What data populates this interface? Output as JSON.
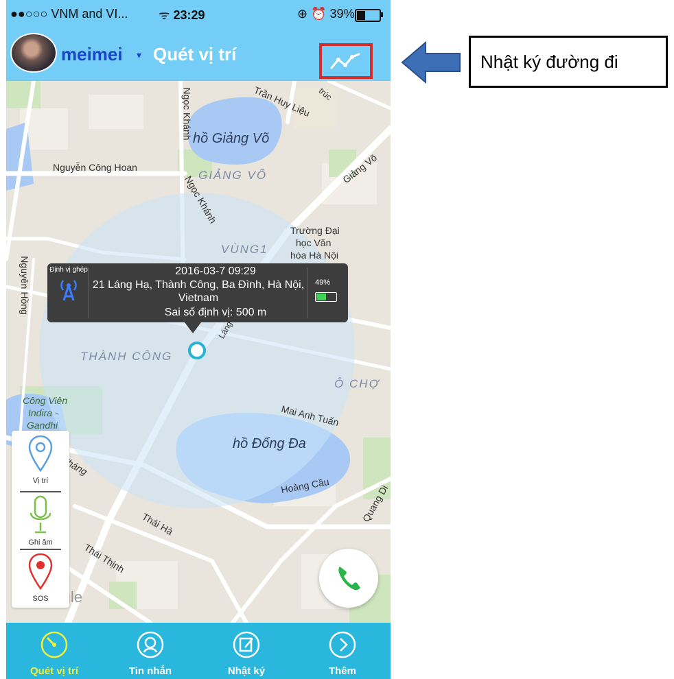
{
  "status_bar": {
    "carrier": "●●○○○ VNM and VI...",
    "time": "23:29",
    "battery": "39%"
  },
  "nav": {
    "user_name": "meimei",
    "title": "Quét vị trí"
  },
  "map": {
    "streets": [
      "Trần Huy Liệu",
      "Nguyễn Công Hoan",
      "Ngọc Khánh",
      "Ngọc Khánh",
      "Giảng Võ",
      "Nguyên Hồng",
      "Mai Anh Tuấn",
      "Hoàng Cầu",
      "Thái Hà",
      "Thái Thịnh",
      "Láng",
      "Tháng",
      "trúc",
      "Quang Di"
    ],
    "districts": [
      "GIẢNG VÕ",
      "VÙNG1",
      "THÀNH CÔNG",
      "Ô CHỢ"
    ],
    "lakes": [
      "hồ Giảng Võ",
      "hồ Đống Đa"
    ],
    "places": {
      "university_line1": "Trường Đại",
      "university_line2": "học Văn",
      "university_line3": "hóa Hà Nội",
      "park_line1": "Công Viên",
      "park_line2": "Indira -",
      "park_line3": "Gandhi"
    },
    "watermark": "Google"
  },
  "location_popup": {
    "type_label": "Định vị ghép",
    "timestamp": "2016-03-7 09:29",
    "address": "21 Láng Hạ, Thành Công, Ba Đình, Hà Nội, Vietnam",
    "accuracy": "Sai số định vị: 500 m",
    "device_battery": "49%"
  },
  "tools": [
    {
      "label": "Vị trí",
      "icon": "location-pin-icon"
    },
    {
      "label": "Ghi âm",
      "icon": "microphone-icon"
    },
    {
      "label": "SOS",
      "icon": "sos-pin-icon"
    }
  ],
  "tabs": [
    {
      "label": "Quét vị trí",
      "icon": "radar-icon",
      "active": true
    },
    {
      "label": "Tin nhắn",
      "icon": "chat-icon",
      "active": false
    },
    {
      "label": "Nhật ký",
      "icon": "journal-icon",
      "active": false
    },
    {
      "label": "Thêm",
      "icon": "chevron-right-icon",
      "active": false
    }
  ],
  "callout": {
    "text": "Nhật ký đường đi"
  },
  "colors": {
    "header": "#74cdf6",
    "tabbar": "#2ab7de",
    "active_tab": "#f3f03a",
    "highlight": "#d62c2c",
    "arrow": "#3d6fb7"
  }
}
